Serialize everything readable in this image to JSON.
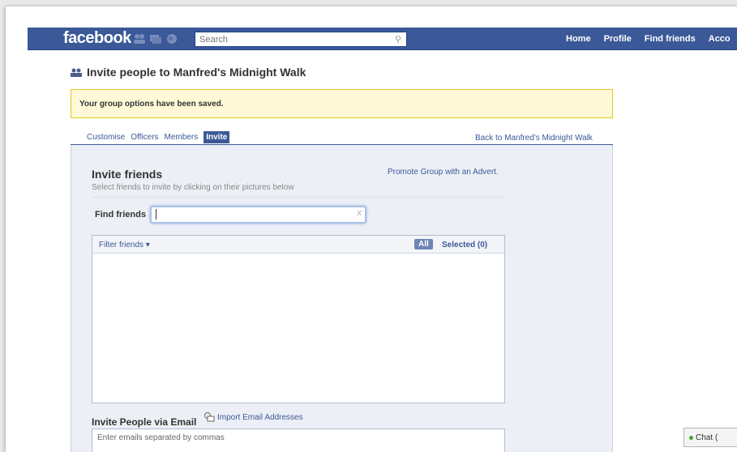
{
  "header": {
    "logo": "facebook",
    "search_placeholder": "Search",
    "nav": [
      "Home",
      "Profile",
      "Find friends",
      "Acco"
    ]
  },
  "page": {
    "title": "Invite people to Manfred's Midnight Walk",
    "notice": "Your group options have been saved."
  },
  "tabs": [
    {
      "label": "Customise",
      "active": false
    },
    {
      "label": "Officers",
      "active": false
    },
    {
      "label": "Members",
      "active": false
    },
    {
      "label": "Invite",
      "active": true
    }
  ],
  "back_link": "Back to Manfred's Midnight Walk",
  "invite": {
    "title": "Invite friends",
    "subtitle": "Select friends to invite by clicking on their pictures below",
    "promote": "Promote Group with an Advert.",
    "find_label": "Find friends",
    "find_value": "",
    "clear_glyph": "x",
    "filter_label": "Filter friends",
    "all_label": "All",
    "selected_label": "Selected (0)"
  },
  "email": {
    "title": "Invite People via Email",
    "import_label": "Import Email Addresses",
    "placeholder": "Enter emails separated by commas"
  },
  "chat": {
    "label": "Chat ("
  },
  "colors": {
    "brand": "#3b5998",
    "notice_bg": "#fff9d7",
    "notice_border": "#e2c822"
  }
}
